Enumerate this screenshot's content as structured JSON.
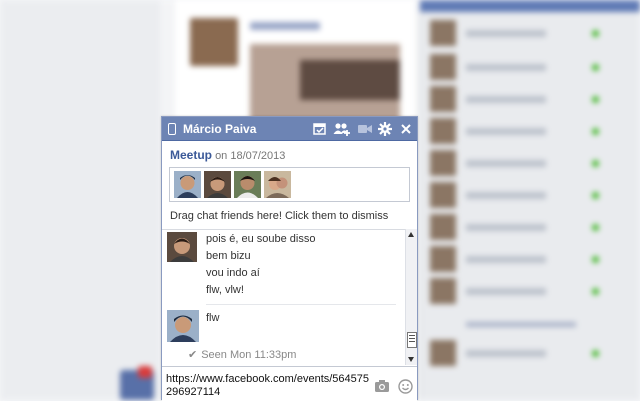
{
  "chat": {
    "title": "Márcio Paiva",
    "event_link": "Meetup",
    "event_date": "on 18/07/2013",
    "drag_hint": "Drag chat friends here! Click them to dismiss",
    "friends": [
      {
        "name": "friend-1"
      },
      {
        "name": "friend-2"
      },
      {
        "name": "friend-3"
      },
      {
        "name": "friend-4"
      }
    ],
    "messages_group_1": [
      "pois é, eu soube disso",
      "bem bizu",
      "vou indo aí",
      "flw, vlw!"
    ],
    "messages_group_2": [
      "flw"
    ],
    "seen_text": "Seen Mon 11:33pm",
    "input_value": "https://www.facebook.com/events/564575296927114",
    "icons": {
      "title": "mobile-phone-icon",
      "tb1": "event-calendar-icon",
      "tb2": "add-friends-icon",
      "tb3": "video-call-icon",
      "tb4": "settings-gear-icon",
      "tb5": "close-icon",
      "input1": "camera-icon",
      "input2": "emoticon-icon"
    },
    "colors": {
      "titlebar": "#6d84b4",
      "link": "#3b5998"
    }
  }
}
